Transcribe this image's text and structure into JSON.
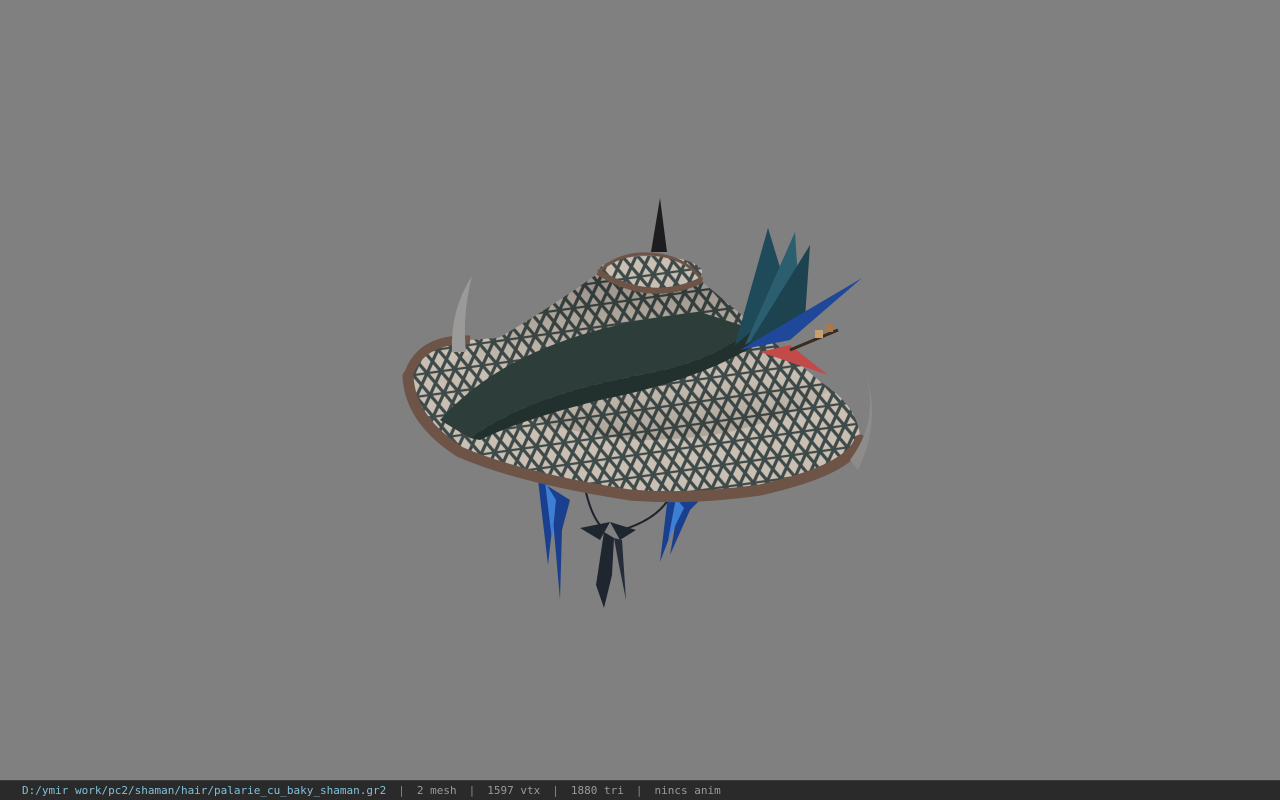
{
  "viewport": {
    "background": "#808080",
    "model": "straw-hat-model"
  },
  "status_bar": {
    "file_path": "D:/ymir work/pc2/shaman/hair/palarie_cu_baky_shaman.gr2",
    "separator": "|",
    "mesh_count": "2 mesh",
    "vertex_count": "1597 vtx",
    "triangle_count": "1880 tri",
    "animation_status": "nincs anim"
  }
}
